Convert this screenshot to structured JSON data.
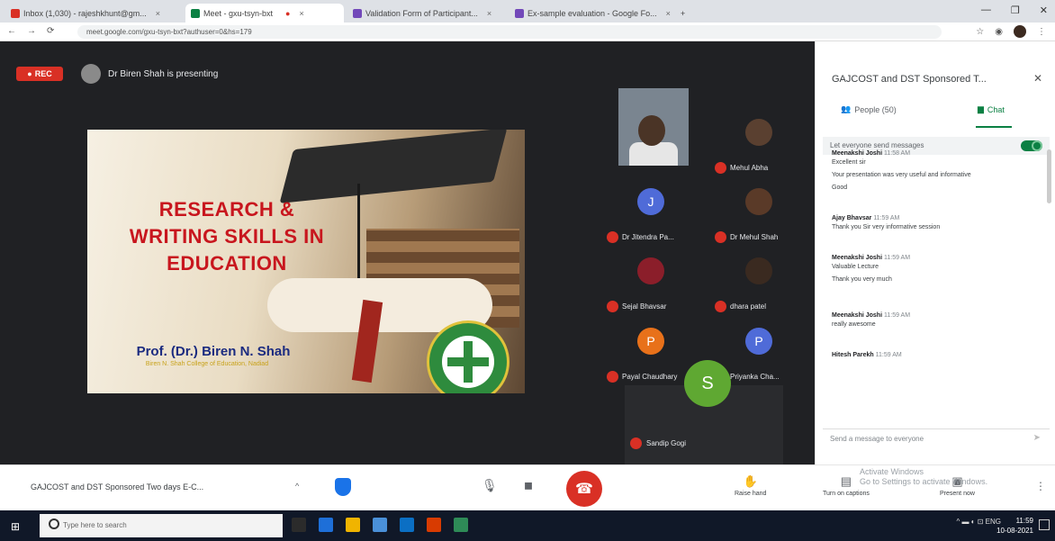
{
  "browser": {
    "tabs": [
      {
        "label": "Inbox (1,030) - rajeshkhunt@gm...",
        "color": "#d93025"
      },
      {
        "label": "Meet - gxu-tsyn-bxt",
        "color": "#0b8043"
      },
      {
        "label": "Validation Form of Participant...",
        "color": "#7248b9"
      },
      {
        "label": "Ex-sample evaluation - Google Fo...",
        "color": "#7248b9"
      }
    ],
    "new_tab": "+",
    "url": "meet.google.com/gxu-tsyn-bxt?authuser=0&hs=179"
  },
  "meet": {
    "rec_label": "REC",
    "presenter_text": "Dr Biren Shah is presenting",
    "slide": {
      "title_lines": [
        "RESEARCH &",
        "WRITING SKILLS IN",
        "EDUCATION"
      ],
      "author": "Prof. (Dr.) Biren N. Shah",
      "subtitle": "Biren N. Shah College of Education, Nadiad"
    },
    "participants": [
      {
        "name": "Mehul Abha",
        "type": "photo",
        "color": "#5a4030"
      },
      {
        "name": "Dr Jitendra Pa...",
        "type": "letter",
        "letter": "J",
        "color": "#4f6bd8"
      },
      {
        "name": "Dr Mehul Shah",
        "type": "photo",
        "color": "#5a3a28"
      },
      {
        "name": "Sejal Bhavsar",
        "type": "photo",
        "color": "#8b1e2a"
      },
      {
        "name": "dhara patel",
        "type": "photo",
        "color": "#3a2a20"
      },
      {
        "name": "Payal Chaudhary",
        "type": "letter",
        "letter": "P",
        "color": "#e8711a"
      },
      {
        "name": "Priyanka Cha...",
        "type": "letter",
        "letter": "P",
        "color": "#4f6bd8"
      }
    ],
    "featured": {
      "name": "Sandip Gogi",
      "letter": "S",
      "color": "#5fa832"
    }
  },
  "chat_panel": {
    "title": "GAJCOST and DST Sponsored T...",
    "tabs": {
      "people": "People (50)",
      "chat": "Chat"
    },
    "toggle_label": "Let everyone send messages",
    "messages": [
      {
        "who": "Meenakshi Joshi",
        "time": "11:58 AM",
        "text": [
          "Excellent sir",
          "Your presentation was very useful and informative",
          "Good"
        ]
      },
      {
        "who": "Ajay Bhavsar",
        "time": "11:59 AM",
        "text": [
          "Thank you Sir very informative session"
        ]
      },
      {
        "who": "Meenakshi Joshi",
        "time": "11:59 AM",
        "text": [
          "Valuable Lecture",
          "Thank you very much"
        ]
      },
      {
        "who": "Meenakshi Joshi",
        "time": "11:59 AM",
        "text": [
          "really awesome"
        ]
      },
      {
        "who": "Hitesh Parekh",
        "time": "11:59 AM",
        "text": []
      }
    ],
    "send_placeholder": "Send a message to everyone",
    "send_icon": "send-icon"
  },
  "controls": {
    "meeting_name": "GAJCOST and DST Sponsored Two days E-C...",
    "caret": "^",
    "raise_hand": "Raise hand",
    "turn_on_captions": "Turn on captions",
    "present_now": "Present now",
    "activate_windows": [
      "Activate Windows",
      "Go to Settings to activate Windows."
    ],
    "more": "⋮"
  },
  "taskbar": {
    "search_placeholder": "Type here to search",
    "clock_time": "11:59",
    "clock_date": "10-08-2021",
    "icons": [
      "#2b2b2b",
      "#1e6fd8",
      "#f0b400",
      "#4a90d9",
      "#0b6fc4",
      "#d83b01",
      "#2e8b57"
    ]
  }
}
